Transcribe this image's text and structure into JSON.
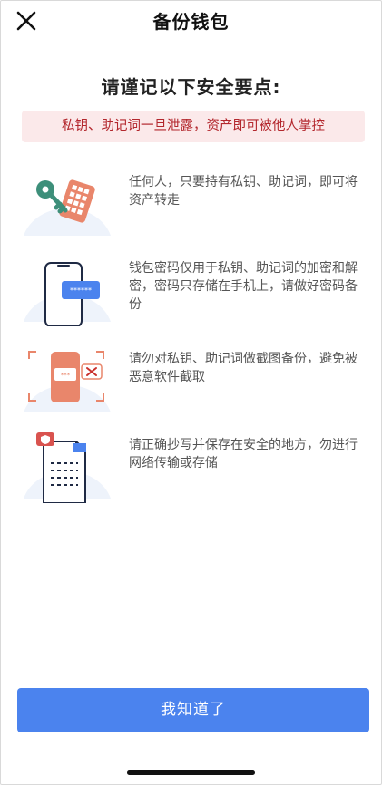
{
  "header": {
    "title": "备份钱包",
    "close_icon": "close-icon"
  },
  "main": {
    "heading": "请谨记以下安全要点:",
    "warning": "私钥、助记词一旦泄露，资产即可被他人掌控",
    "tips": [
      {
        "icon": "key-and-mnemonic-illustration",
        "text": "任何人，只要持有私钥、助记词，即可将资产转走"
      },
      {
        "icon": "phone-password-illustration",
        "text": "钱包密码仅用于私钥、助记词的加密和解密，密码只存储在手机上，请做好密码备份"
      },
      {
        "icon": "no-screenshot-illustration",
        "text": "请勿对私钥、助记词做截图备份，避免被恶意软件截取"
      },
      {
        "icon": "paper-backup-illustration",
        "text": "请正确抄写并保存在安全的地方，勿进行网络传输或存储"
      }
    ]
  },
  "footer": {
    "confirm_label": "我知道了"
  },
  "colors": {
    "accent": "#4b83ee",
    "warning_bg": "#fbe9ea",
    "warning_text": "#b3272d"
  }
}
